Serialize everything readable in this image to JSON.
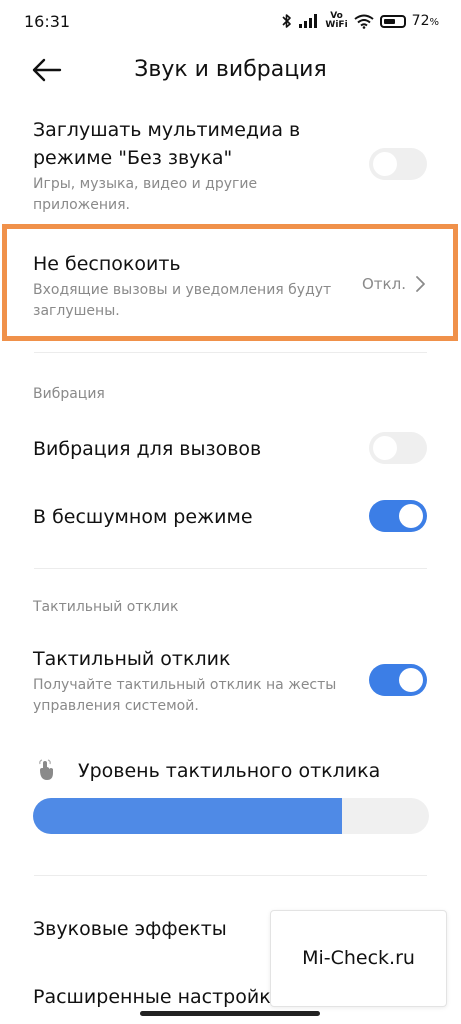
{
  "status_bar": {
    "time": "16:31",
    "vowifi_top": "Vo",
    "vowifi_bottom": "WiFi",
    "battery_text": "72",
    "battery_unit": "%",
    "battery_level": 0.72
  },
  "header": {
    "title": "Звук и вибрация",
    "back_icon": "arrow-left-icon"
  },
  "settings": {
    "mute_media": {
      "title_line1": "Заглушать мультимедиа в",
      "title_line2": "режиме \"Без звука\"",
      "subtitle_line1": "Игры, музыка, видео и другие",
      "subtitle_line2": "приложения.",
      "enabled": false
    },
    "dnd": {
      "title": "Не беспокоить",
      "subtitle_line1": "Входящие вызовы и уведомления будут",
      "subtitle_line2": "заглушены.",
      "value": "Откл.",
      "highlight_color": "#f0914a"
    },
    "vibration_section": "Вибрация",
    "vibrate_calls": {
      "title": "Вибрация для вызовов",
      "enabled": false
    },
    "vibrate_silent": {
      "title": "В бесшумном режиме",
      "enabled": true
    },
    "haptic_section": "Тактильный отклик",
    "haptic": {
      "title": "Тактильный отклик",
      "subtitle_line1": "Получайте тактильный отклик на жесты",
      "subtitle_line2": "управления системой.",
      "enabled": true
    },
    "haptic_level": {
      "title": "Уровень тактильного отклика",
      "level_fraction": 0.78,
      "icon": "tap-hand-icon"
    },
    "sound_effects": {
      "title": "Звуковые эффекты"
    },
    "advanced": {
      "title": "Расширенные настройки"
    }
  },
  "watermark": {
    "text": "Mi-Check.ru"
  },
  "colors": {
    "accent": "#3c7ee6",
    "slider_fill": "#4f8ae6",
    "toggle_off": "#efefef",
    "highlight": "#f0914a"
  }
}
